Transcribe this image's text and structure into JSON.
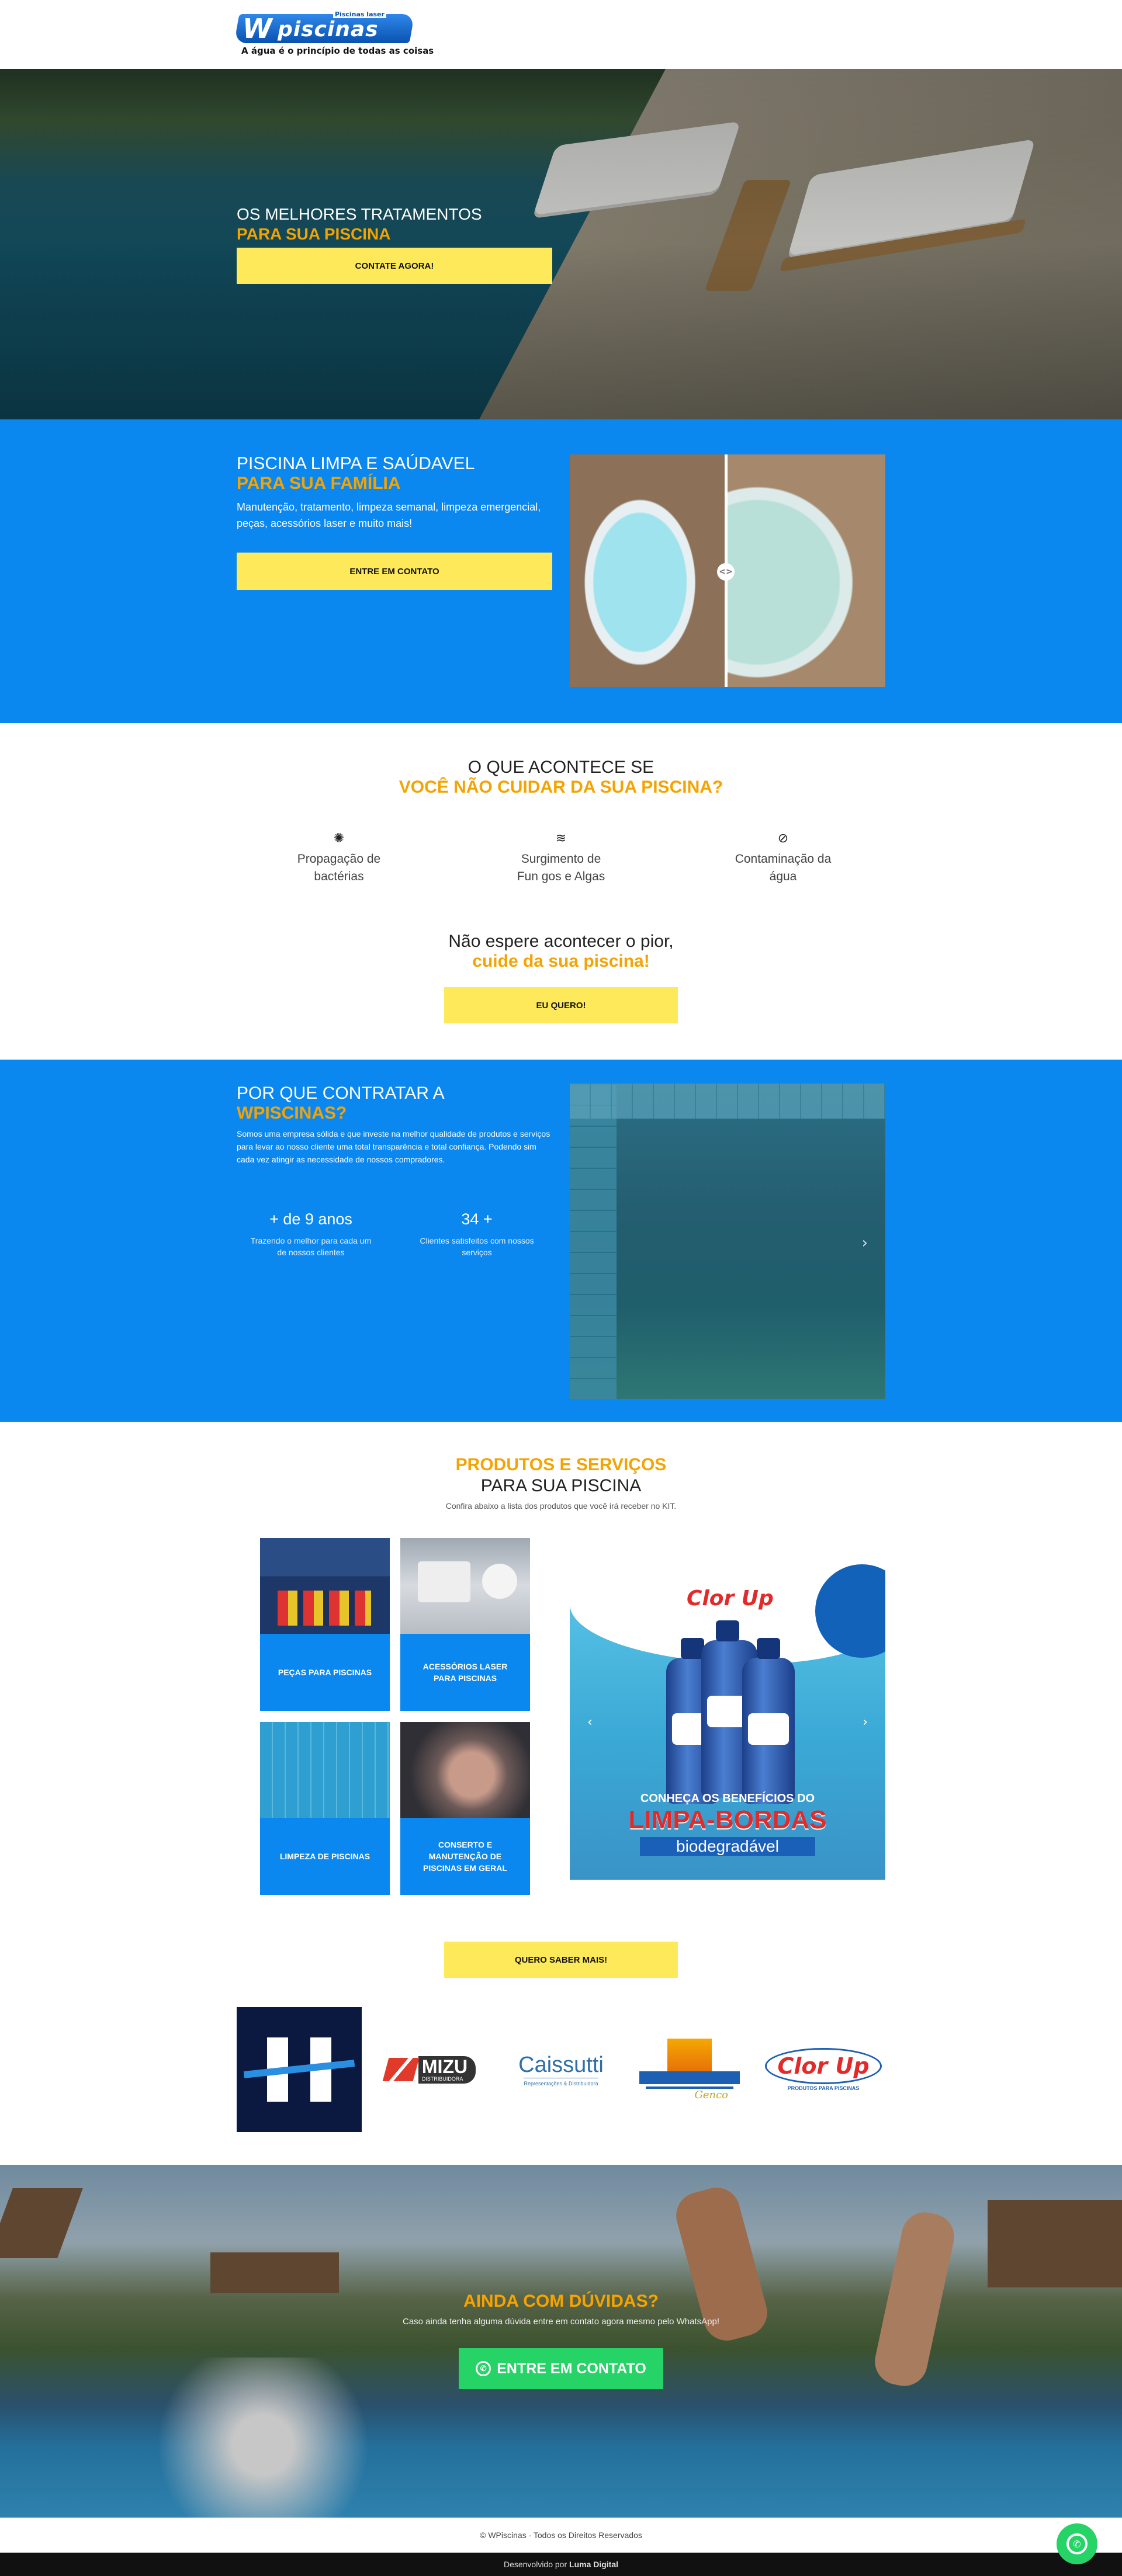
{
  "header": {
    "logo_text": "piscinas",
    "logo_w": "W",
    "logo_sub": "Piscinas laser",
    "slogan": "A água é o princípio de todas as coisas"
  },
  "hero": {
    "title_line1": "OS MELHORES TRATAMENTOS",
    "title_line2": "PARA SUA PISCINA",
    "button": "CONTATE AGORA!"
  },
  "clean": {
    "title_line1": "PISCINA LIMPA E SAÚDAVEL",
    "title_line2": "PARA SUA FAMÍLIA",
    "text": "Manutenção, tratamento, limpeza semanal, limpeza emergencial, peças, acessórios laser e muito mais!",
    "button": "ENTRE EM CONTATO",
    "compare_handle": "<>"
  },
  "problems": {
    "title_line1": "O QUE ACONTECE SE",
    "title_line2": "VOCÊ NÃO CUIDAR DA SUA PISCINA?",
    "items": [
      {
        "icon": "bacteria-icon",
        "line1": "Propagação de",
        "line2": "bactérias"
      },
      {
        "icon": "waves-icon",
        "line1": "Surgimento de",
        "line2": "Fun gos e Algas"
      },
      {
        "icon": "contamination-icon",
        "line1": "Contaminação da",
        "line2": "água"
      }
    ],
    "cta_line1": "Não espere acontecer o pior,",
    "cta_line2": "cuide da sua piscina!",
    "button": "EU QUERO!"
  },
  "why": {
    "title_line1": "POR QUE CONTRATAR A",
    "title_line2": "WPISCINAS?",
    "text": "Somos uma empresa sólida e que investe na melhor qualidade de produtos e serviços para levar ao nosso cliente uma total transparência e total confiança. Podendo sim cada vez atingir as necessidade de nossos compradores.",
    "stats": [
      {
        "number": "+ de 9 anos",
        "label": "Trazendo o melhor para cada um de nossos clientes"
      },
      {
        "number": "34 +",
        "label": "Clientes satisfeitos com nossos serviços"
      }
    ],
    "slider_next": "›"
  },
  "products": {
    "title_line1": "PRODUTOS E SERVIÇOS",
    "title_line2": "PARA SUA PISCINA",
    "subtitle": "Confira abaixo a lista dos produtos que você irá receber no KIT.",
    "tiles": [
      {
        "label": "PEÇAS PARA PISCINAS"
      },
      {
        "label": "ACESSÓRIOS LASER PARA PISCINAS"
      },
      {
        "label": "LIMPEZA DE PISCINAS"
      },
      {
        "label": "CONSERTO E MANUTENÇÃO DE PISCINAS EM GERAL"
      }
    ],
    "promo": {
      "brand": "Clor Up",
      "line1": "CONHEÇA OS BENEFÍCIOS DO",
      "line2": "LIMPA-BORDAS",
      "line3": "biodegradável",
      "prev": "‹",
      "next": "›"
    },
    "button": "QUERO SABER MAIS!"
  },
  "brands": {
    "items": [
      {
        "name": "H"
      },
      {
        "name": "MIZU",
        "sub": "DISTRIBUIDORA"
      },
      {
        "name": "Caissutti",
        "sub": "Representações & Distribuidora"
      },
      {
        "name": "Genco"
      },
      {
        "name": "Clor Up",
        "sub": "PRODUTOS PARA PISCINAS"
      }
    ]
  },
  "cta": {
    "title": "AINDA COM DÚVIDAS?",
    "text": "Caso ainda tenha alguma dúvida entre em contato agora mesmo pelo WhatsApp!",
    "button": "ENTRE EM CONTATO"
  },
  "footer": {
    "copyright": "© WPiscinas - Todos os Direitos Reservados",
    "dev_prefix": "Desenvolvido por",
    "dev_name": "Luma Digital"
  },
  "colors": {
    "brand_blue": "#0b87f0",
    "accent_orange": "#f5a300",
    "button_yellow": "#fde95a",
    "whatsapp_green": "#25d366"
  }
}
